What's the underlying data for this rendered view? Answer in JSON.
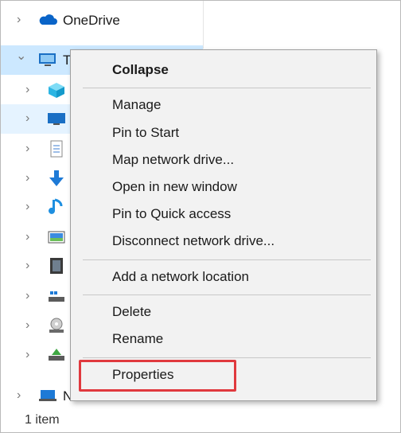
{
  "nav": {
    "onedrive_label": "OneDrive",
    "thispc_label_partial": "T",
    "network_label": "Network",
    "chevron_right": "›",
    "chevron_down": "⌄"
  },
  "status_bar": {
    "item_count": "1 item"
  },
  "context_menu": {
    "collapse": "Collapse",
    "manage": "Manage",
    "pin_to_start": "Pin to Start",
    "map_network_drive": "Map network drive...",
    "open_in_new_window": "Open in new window",
    "pin_to_quick_access": "Pin to Quick access",
    "disconnect_network_drive": "Disconnect network drive...",
    "add_network_location": "Add a network location",
    "delete": "Delete",
    "rename": "Rename",
    "properties": "Properties"
  },
  "colors": {
    "selection_bg": "#cce8ff",
    "hover_bg": "#e5f3ff",
    "menu_bg": "#f2f2f2",
    "highlight_border": "#e0393e"
  },
  "icons": [
    "onedrive-cloud-icon",
    "this-pc-icon",
    "3d-objects-icon",
    "desktop-icon",
    "documents-icon",
    "downloads-icon",
    "music-icon",
    "pictures-icon",
    "videos-icon",
    "local-disk-icon",
    "dvd-drive-icon",
    "network-drive-icon",
    "network-icon"
  ]
}
